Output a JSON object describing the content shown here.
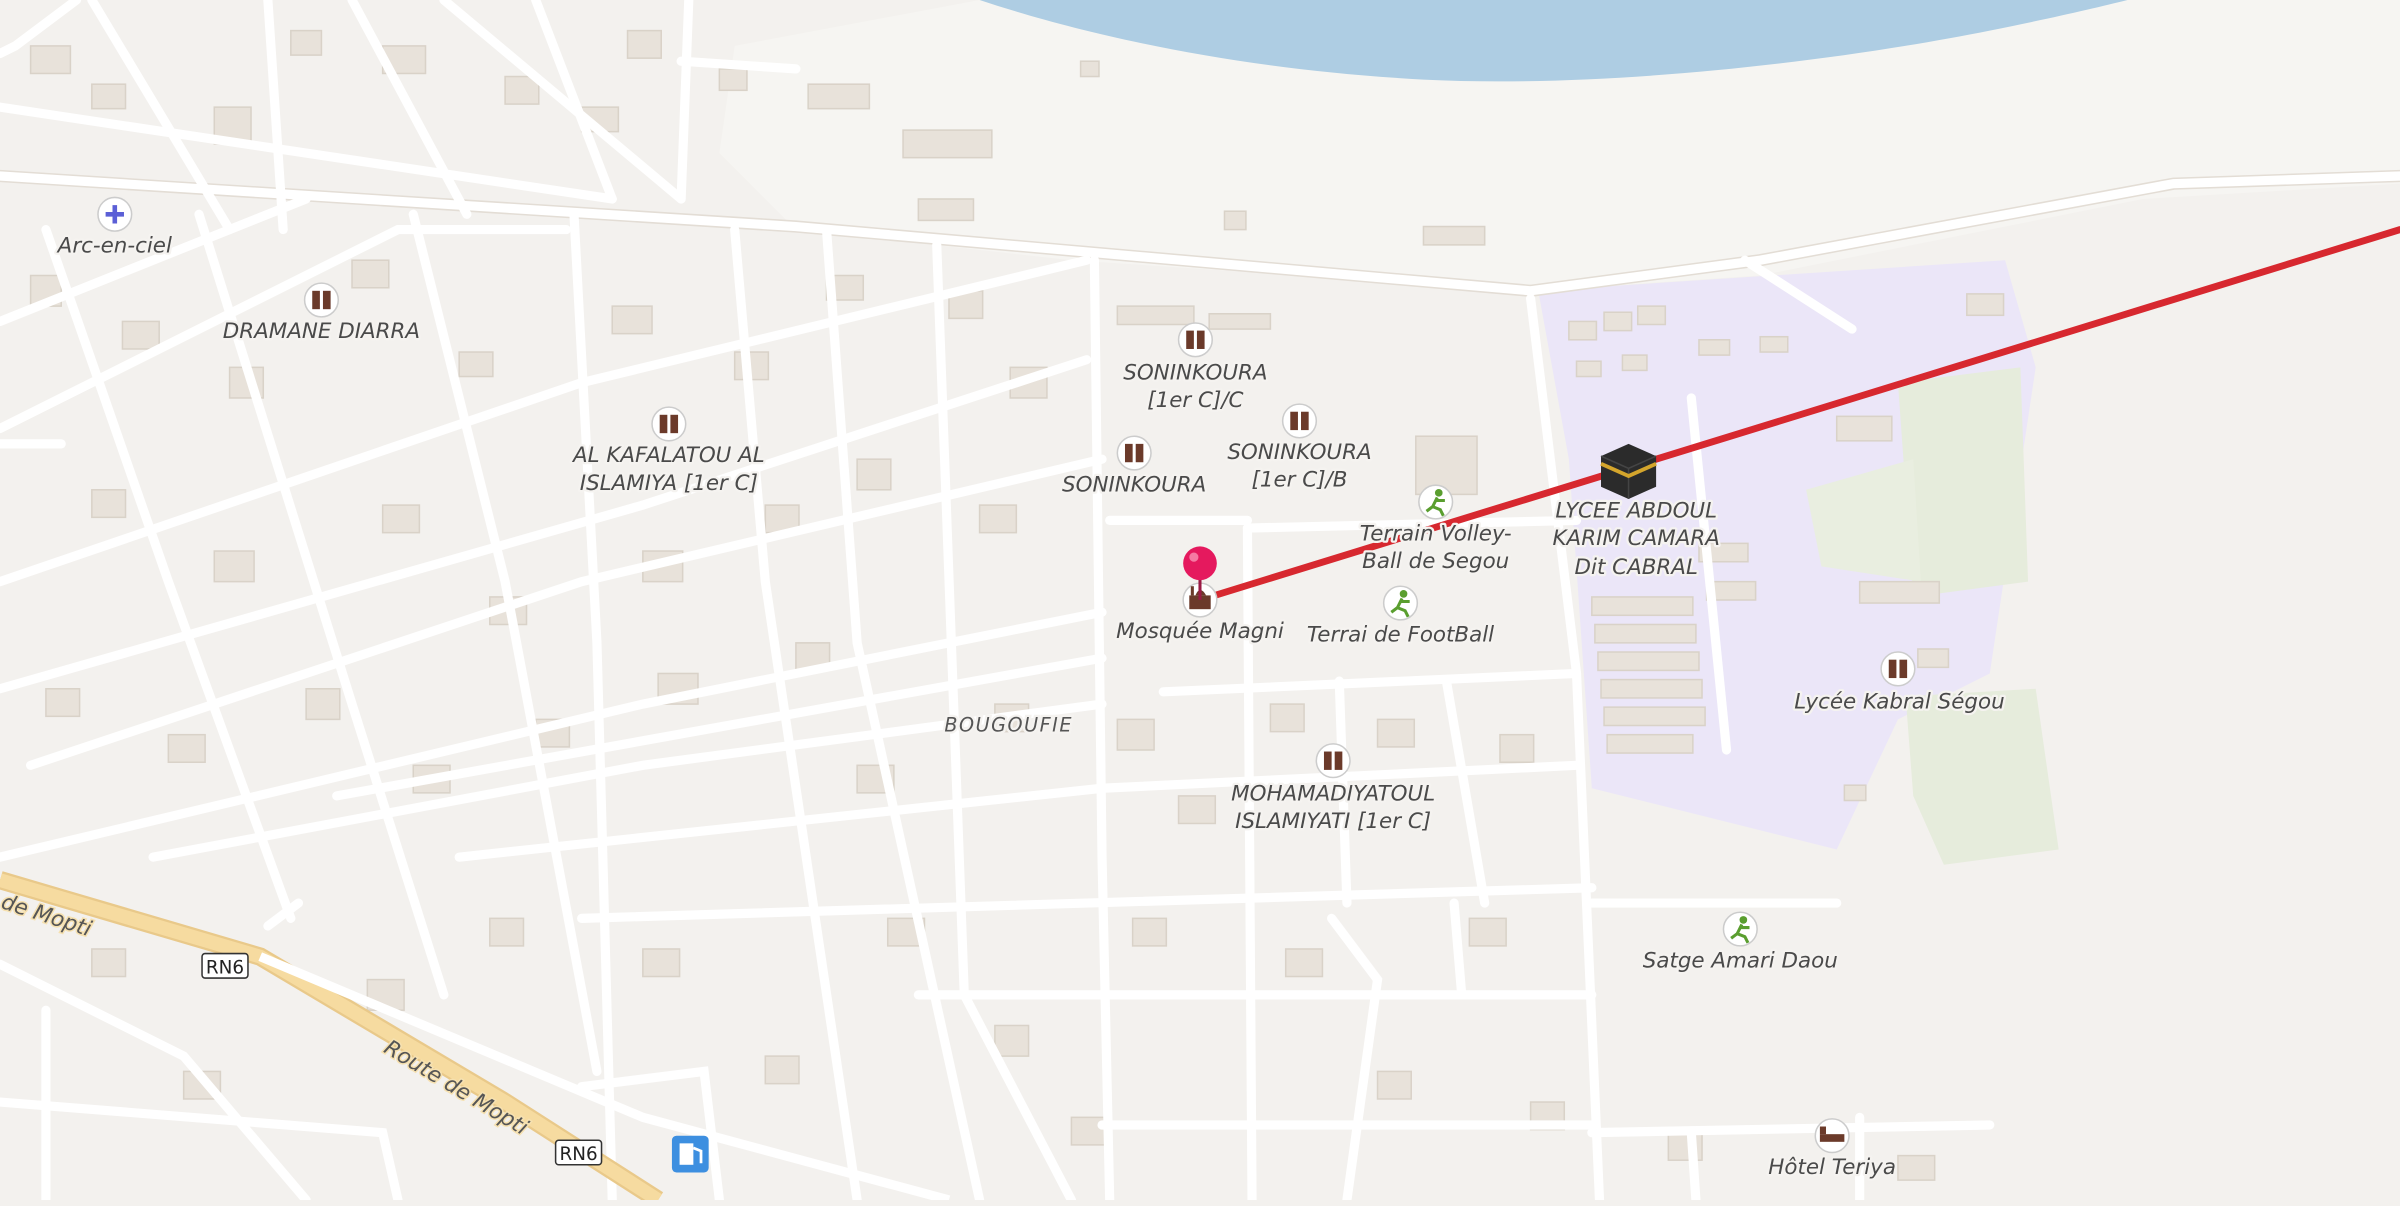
{
  "map": {
    "district": "BOUGOUFIE",
    "roads": [
      {
        "name": "Route de Mopti",
        "ref": "RN6"
      },
      {
        "name": "de Mopti"
      }
    ],
    "road_shields": [
      "RN6",
      "RN6"
    ],
    "pois": [
      {
        "name": "Arc-en-ciel",
        "icon": "pharmacy-icon"
      },
      {
        "name": "DRAMANE DIARRA",
        "icon": "school-icon"
      },
      {
        "name": "AL KAFALATOU AL",
        "name2": "ISLAMIYA [1er C]",
        "icon": "school-icon"
      },
      {
        "name": "SONINKOURA",
        "name2": "[1er C]/C",
        "icon": "school-icon"
      },
      {
        "name": "SONINKOURA",
        "name2": "[1er C]/B",
        "icon": "school-icon"
      },
      {
        "name": "SONINKOURA",
        "icon": "school-icon"
      },
      {
        "name": "Terrain Volley-",
        "name2": "Ball de Segou",
        "icon": "sports-icon"
      },
      {
        "name": "Mosquée Magni",
        "icon": "mosque-icon"
      },
      {
        "name": "Terrai de FootBall",
        "icon": "sports-icon"
      },
      {
        "name": "LYCEE ABDOUL",
        "name2": "KARIM CAMARA",
        "name3": "Dit CABRAL",
        "icon": "kaaba-icon"
      },
      {
        "name": "Lycée Kabral Ségou",
        "icon": "school-icon"
      },
      {
        "name": "MOHAMADIYATOUL",
        "name2": "ISLAMIYATI [1er C]",
        "icon": "school-icon"
      },
      {
        "name": "Satge Amari Daou",
        "icon": "sports-icon"
      },
      {
        "name": "Hôtel Teriya",
        "icon": "hotel-icon"
      }
    ],
    "fuel_icon": "fuel-station-icon",
    "selected_pin": "location-pin-icon",
    "colors": {
      "land": "#f3f1ee",
      "water": "#aecde3",
      "school_area": "#ece8f7",
      "park": "#e6ecdc",
      "route_line": "#d7282f",
      "main_road": "#f6dba0",
      "pin": "#e5195e",
      "poi_icon": "#6b3a2a",
      "sports_icon": "#5a9e2f",
      "fuel": "#3d8fe0"
    }
  }
}
